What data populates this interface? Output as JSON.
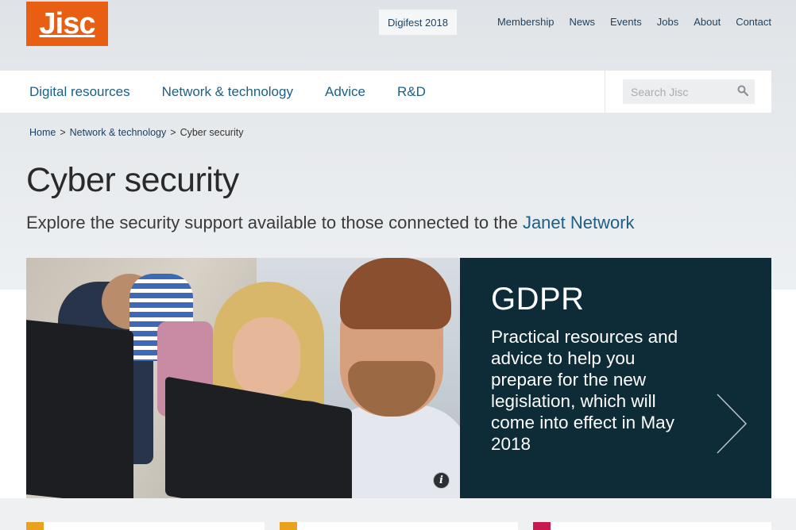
{
  "header": {
    "logo_text": "Jisc",
    "promo_link": "Digifest 2018",
    "top_links": [
      "Membership",
      "News",
      "Events",
      "Jobs",
      "About",
      "Contact"
    ]
  },
  "nav": {
    "items": [
      "Digital resources",
      "Network & technology",
      "Advice",
      "R&D"
    ],
    "search_placeholder": "Search Jisc"
  },
  "breadcrumb": {
    "home": "Home",
    "section": "Network & technology",
    "current": "Cyber security",
    "separator": ">"
  },
  "page": {
    "title": "Cyber security",
    "subtitle_prefix": "Explore the security support available to those connected to the ",
    "subtitle_link": "Janet Network"
  },
  "feature": {
    "title": "GDPR",
    "description": "Practical resources and advice to help you prepare for the new legislation, which will come into effect in May 2018",
    "info_icon": "i"
  },
  "colors": {
    "brand_orange": "#e85e13",
    "link_blue": "#1d5f86",
    "feature_panel": "#0e2b38",
    "card_tag_1": "#e8a21e",
    "card_tag_2": "#e8a21e",
    "card_tag_3": "#c8194f"
  }
}
